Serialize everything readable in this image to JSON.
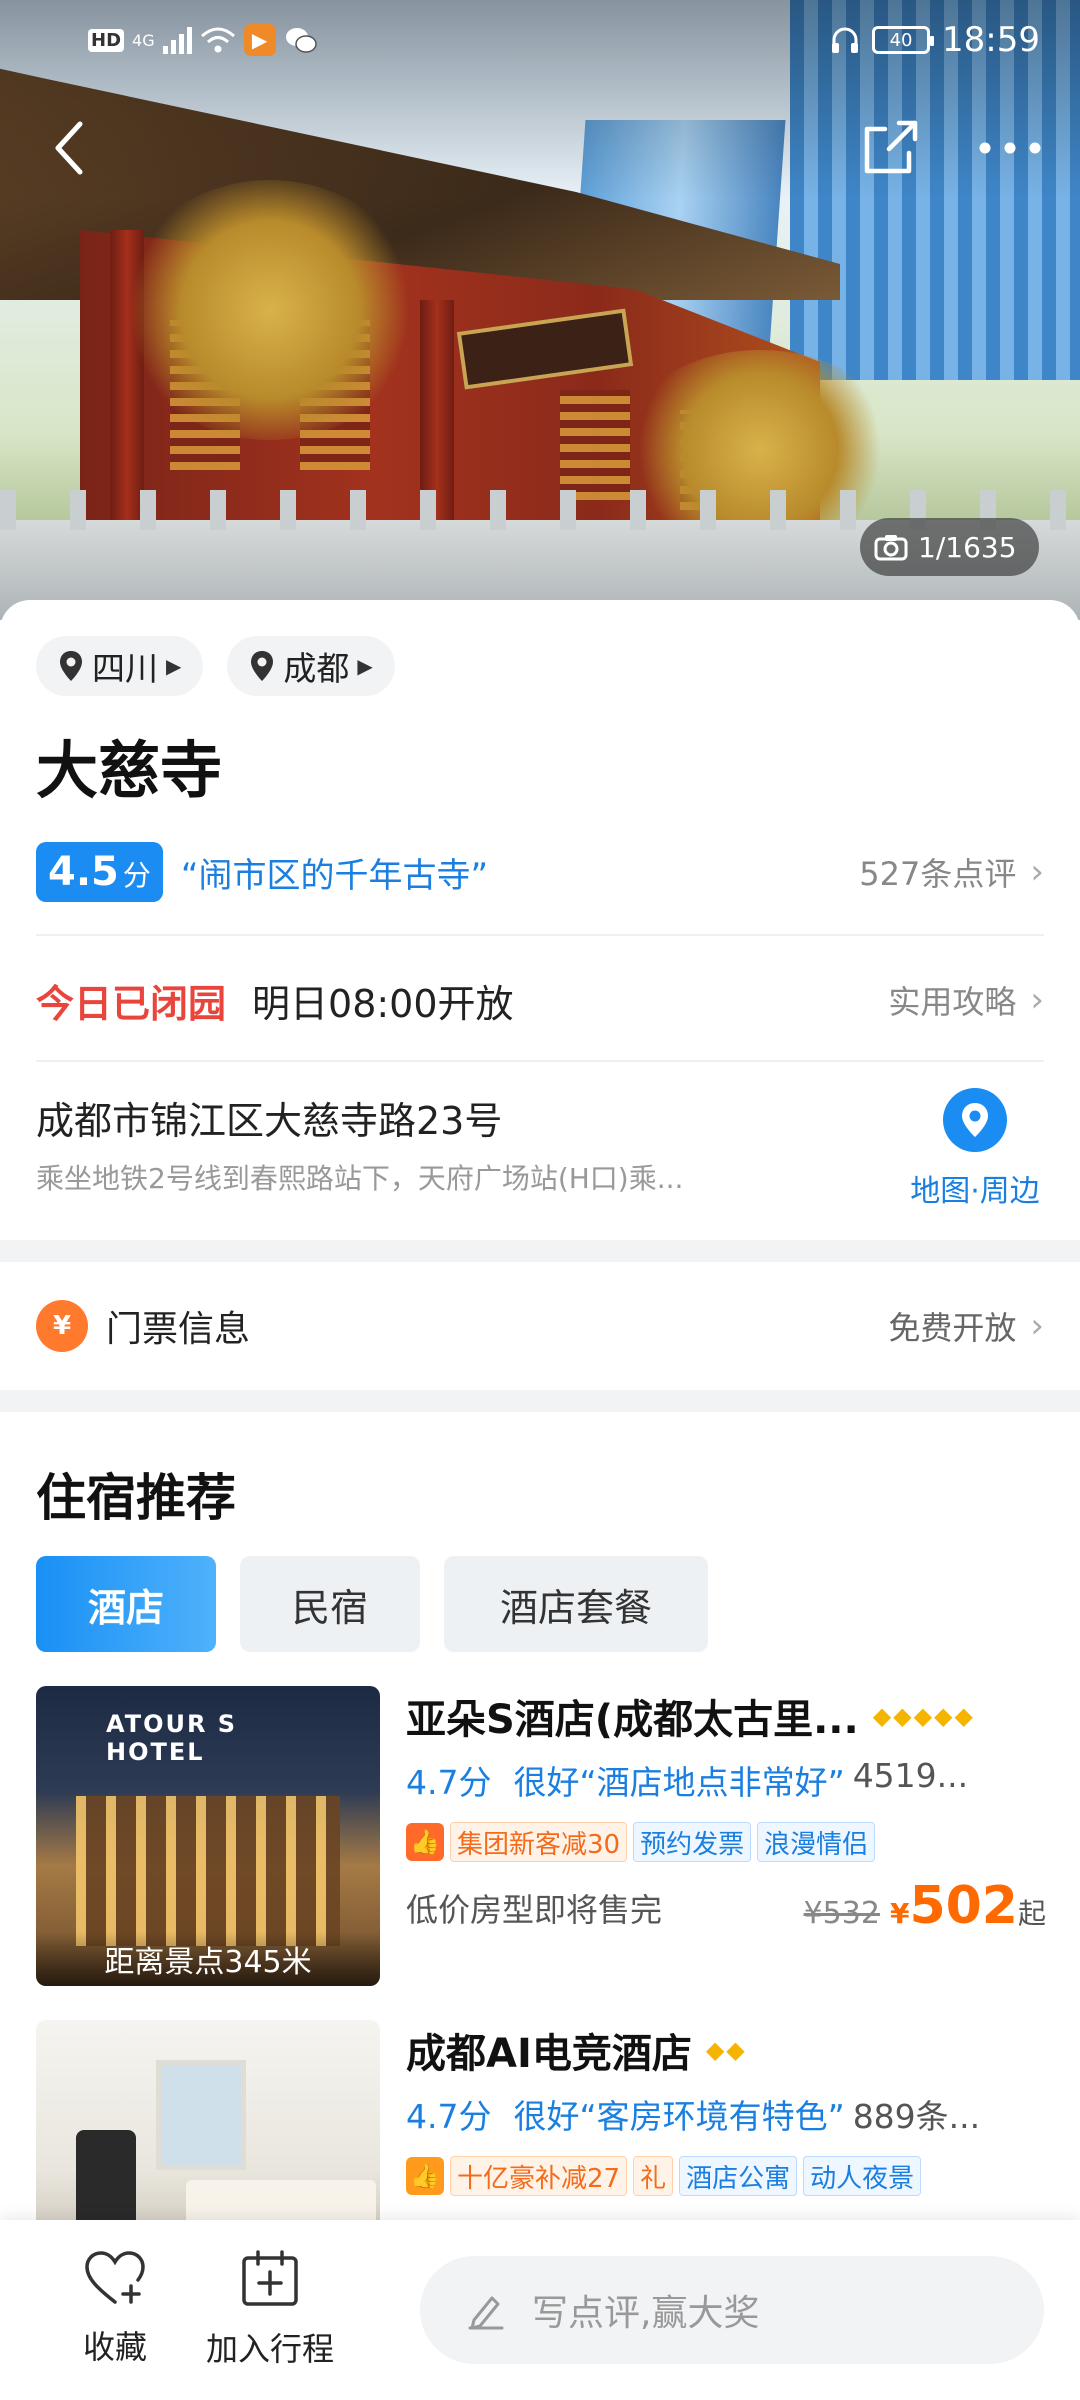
{
  "status_bar": {
    "network_badge": "HD",
    "network_type": "4G",
    "time": "18:59",
    "battery": "40"
  },
  "hero": {
    "photo_count": "1/1635"
  },
  "location_tags": [
    {
      "label": "四川"
    },
    {
      "label": "成都"
    }
  ],
  "attraction": {
    "name": "大慈寺",
    "score": "4.5",
    "score_unit": "分",
    "highlight": "“闹市区的千年古寺”",
    "reviews": "527条点评",
    "closed_status": "今日已闭园",
    "open_time": "明日08:00开放",
    "guide_link": "实用攻略",
    "address": "成都市锦江区大慈寺路23号",
    "transit": "乘坐地铁2号线到春熙路站下，天府广场站(H口)乘...",
    "map_label": "地图·周边"
  },
  "ticket": {
    "icon_text": "¥",
    "label": "门票信息",
    "value": "免费开放"
  },
  "lodging": {
    "title": "住宿推荐",
    "tabs": [
      {
        "label": "酒店",
        "active": true
      },
      {
        "label": "民宿",
        "active": false
      },
      {
        "label": "酒店套餐",
        "active": false
      }
    ],
    "hotels": [
      {
        "name": "亚朵S酒店(成都太古里...",
        "image_sign": "ATOUR S HOTEL",
        "diamonds": "◆◆◆◆◆",
        "score": "4.7分",
        "level": "很好",
        "quote": "“酒店地点非常好”",
        "review_count": "4519...",
        "distance": "距离景点345米",
        "tags": [
          "集团新客减30",
          "预约发票",
          "浪漫情侣"
        ],
        "note": "低价房型即将售完",
        "old_price": "¥532",
        "currency": "¥",
        "price": "502",
        "price_suffix": "起"
      },
      {
        "name": "成都AI电竞酒店",
        "diamonds": "◆◆",
        "score": "4.7分",
        "level": "很好",
        "quote": "“客房环境有特色”",
        "review_count": "889条...",
        "tags": [
          "十亿豪补减27",
          "礼",
          "酒店公寓",
          "动人夜景"
        ]
      }
    ]
  },
  "bottom_bar": {
    "favorite": "收藏",
    "add_trip": "加入行程",
    "review_placeholder": "写点评,赢大奖"
  },
  "icons": {
    "accent": "#1a8cf2",
    "price": "#ff6a00",
    "closed": "#e8463c"
  }
}
